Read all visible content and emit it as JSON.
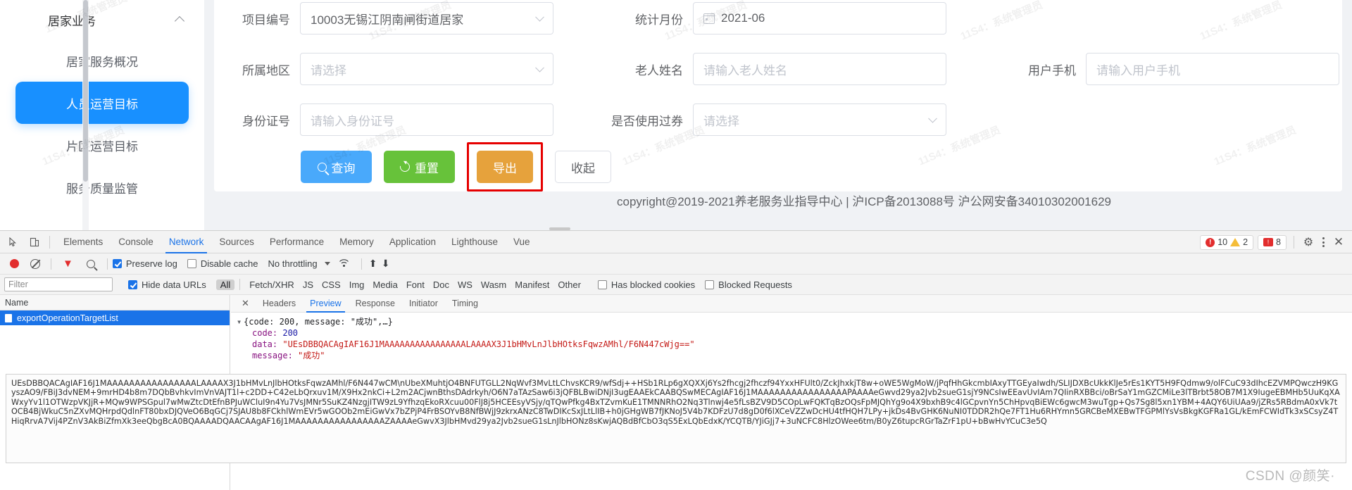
{
  "sidebar": {
    "group": {
      "label": "居家业务",
      "icon": "chevron-up-icon"
    },
    "items": [
      {
        "label": "居家服务概况",
        "active": false
      },
      {
        "label": "人员运营目标",
        "active": true
      },
      {
        "label": "片区运营目标",
        "active": false
      },
      {
        "label": "服务质量监管",
        "active": false
      }
    ]
  },
  "form": {
    "fields": [
      {
        "label": "项目编号",
        "value": "10003无锡江阴南闸街道居家",
        "placeholder": "",
        "type": "select",
        "icon": "chevron-down-icon"
      },
      {
        "label": "统计月份",
        "value": "2021-06",
        "placeholder": "",
        "type": "date",
        "icon": "calendar-icon"
      },
      {
        "label": "所属地区",
        "value": "",
        "placeholder": "请选择",
        "type": "select",
        "icon": "chevron-down-icon"
      },
      {
        "label": "老人姓名",
        "value": "",
        "placeholder": "请输入老人姓名",
        "type": "text",
        "icon": ""
      },
      {
        "label": "用户手机",
        "value": "",
        "placeholder": "请输入用户手机",
        "type": "text",
        "icon": ""
      },
      {
        "label": "身份证号",
        "value": "",
        "placeholder": "请输入身份证号",
        "type": "text",
        "icon": ""
      },
      {
        "label": "是否使用过券",
        "value": "",
        "placeholder": "请选择",
        "type": "select",
        "icon": "chevron-down-icon"
      }
    ],
    "buttons": {
      "query": {
        "label": "查询",
        "icon": "search-icon",
        "color": "#49a9fb"
      },
      "reset": {
        "label": "重置",
        "icon": "refresh-icon",
        "color": "#67c23a"
      },
      "export": {
        "label": "导出",
        "color": "#e6a23c",
        "highlight_color": "#e60000"
      },
      "collapse": {
        "label": "收起",
        "color": "#ffffff"
      }
    }
  },
  "footer": {
    "copyright": "copyright@2019-2021养老服务业指导中心 | 沪ICP备2013088号 沪公网安备34010302001629"
  },
  "watermark": {
    "text": "11S4：系统管理员",
    "csdn": "CSDN @颜笑·"
  },
  "devtools": {
    "tabs": [
      {
        "label": "Elements",
        "selected": false
      },
      {
        "label": "Console",
        "selected": false
      },
      {
        "label": "Network",
        "selected": true
      },
      {
        "label": "Sources",
        "selected": false
      },
      {
        "label": "Performance",
        "selected": false
      },
      {
        "label": "Memory",
        "selected": false
      },
      {
        "label": "Application",
        "selected": false
      },
      {
        "label": "Lighthouse",
        "selected": false
      },
      {
        "label": "Vue",
        "selected": false
      }
    ],
    "counts": {
      "errors": "10",
      "warnings": "2",
      "issues": "8"
    },
    "icons": {
      "inspect": "inspect-element-icon",
      "device": "device-toolbar-icon",
      "gear": "settings-gear-icon",
      "kebab": "more-options-icon",
      "close": "close-devtools-icon"
    },
    "network_toolbar": {
      "record": "record-icon",
      "clear": "clear-icon",
      "filter": "filter-funnel-icon",
      "search": "search-icon",
      "preserve_log": "Preserve log",
      "preserve_log_checked": true,
      "disable_cache": "Disable cache",
      "disable_cache_checked": false,
      "throttling": "No throttling",
      "wifi": "network-conditions-icon",
      "import": "import-har-icon",
      "export": "export-har-icon"
    },
    "filter_bar": {
      "filter_placeholder": "Filter",
      "hide_data_urls": "Hide data URLs",
      "hide_data_urls_checked": true,
      "types": [
        "All",
        "Fetch/XHR",
        "JS",
        "CSS",
        "Img",
        "Media",
        "Font",
        "Doc",
        "WS",
        "Wasm",
        "Manifest",
        "Other"
      ],
      "selected_type": "All",
      "has_blocked_cookies": "Has blocked cookies",
      "blocked_requests": "Blocked Requests"
    },
    "request_list": {
      "column_header": "Name",
      "rows": [
        {
          "name": "exportOperationTargetList",
          "selected": true
        }
      ]
    },
    "response_tabs": [
      {
        "label": "Headers",
        "selected": false
      },
      {
        "label": "Preview",
        "selected": true
      },
      {
        "label": "Response",
        "selected": false
      },
      {
        "label": "Initiator",
        "selected": false
      },
      {
        "label": "Timing",
        "selected": false
      }
    ],
    "preview": {
      "root_line": "{code: 200, message: \"成功\",…}",
      "code_key": "code:",
      "code_value": "200",
      "data_key": "data:",
      "data_value": "\"UEsDBBQACAgIAF16J1MAAAAAAAAAAAAAAAALAAAAX3J1bHMvLnJlbHOtksFqwzAMhl/F6N447cWjg==\"",
      "message_key": "message:",
      "message_value": "\"成功\"",
      "blob": "UEsDBBQACAgIAF16J1MAAAAAAAAAAAAAAAALAAAAX3J1bHMvLnJlbHOtksFqwzAMhl/F6N447wCM\\nUbeXMuhtjO4BNFUTGLL2NqWvf3MvLtLChvsKCR9/wfSdj++HSb1RLp6gXQXXj6Ys2fhcgj2fhczf94YxxHFUlt0/ZckJhxkjT8w+oWE5WgMoW/jPqfHhGkcmbIAxyTTGEyaIwdh/SLIJDXBcUkkKlJe5rEs1KYT5H9FQdmw9/olFCuC93dIhcEZVMPQwczH9KGyszAO9/FBiJ3dvNEM+9mrHD4b8m7DQbBvhkvImVnVAJT1l+c2DD+C42eLbQrxuv1M/X9Hx2nkCi+L2m2ACjwnBthsDAdrkyh/O6N7aTAzSaw6i3jQFBLBwiDNjI3ugEAAEkCAABQSwMECAgIAF16J1MAAAAAAAAAAAAAAAAPAAAAeGwvd29ya2Jvb2sueG1sjY9NCsIwEEavUvIAm7QIinRXBBci/oBrSaY1mGZCMiLe3lTBrbt58OB7M1X9IugeEBMHb5UuKqXAWxyYv1l1OTWzpVKJjR+MQw9WPSGpul7wMwZtcDtEfnBPJuWCluI9n4Yu7VsJMNr5SuKZ4NzgjITW9zL9YfhzqEkoRXcuu00FlJ8j5HCEEsyVSjy/qTQwPfkg4BxTZvmKuE1TMNNRhO2Nq3Tlnwj4e5fLsBZV9D5COpLwFQKTqBzOQsFpMJQhYg9o4X9bxhB9c4lGCpvnYn5ChHpvqBiEWc6gwcM3wuTgp+Qs7Sg8l5xn1YBM+4AQY6UiUAa9/jZRs5RBdmA0xVk7tOCB4BjWkuC5nZXvMQHrpdQdlnFT80bxDJQVeO6BqGCj7SJAU8b8FCkhlWmEVr5wGOOb2mEiGwVx7bZPjP4FrBSOYvB8NfBWjJ9zkrxANzC8TwDIKcSxJLtLlIB+h0jGHgWB7fJKNoJ5V4b7KDFzU7d8gD0f6lXCeVZZwDcHU4tfHQH7LPy+jkDs4BvGHK6NuNI0TDDR2hQe7FT1Hu6RHYmn5GRCBeMXEBwTFGPMlYsVsBkgKGFRa1GL/kEmFCWIdTk3xSCsyZ4THiqRrvA7Vij4PZnV3AkBiZfmXk3eeQbgBcA0BQAAAADQAACAAgAF16J1MAAAAAAAAAAAAAAAAZAAAAeGwvX3JlbHMvd29ya2Jvb2sueG1sLnJlbHONz8sKwjAQBdBfCbO3qS5ExLQbEdxK/YCQTB/YJiGJj7+3uNCFC8HlzOWee6tm/B0yZ6tupcRGrTaZrF1pU+bBwHvYCuC3e5Q"
    }
  }
}
